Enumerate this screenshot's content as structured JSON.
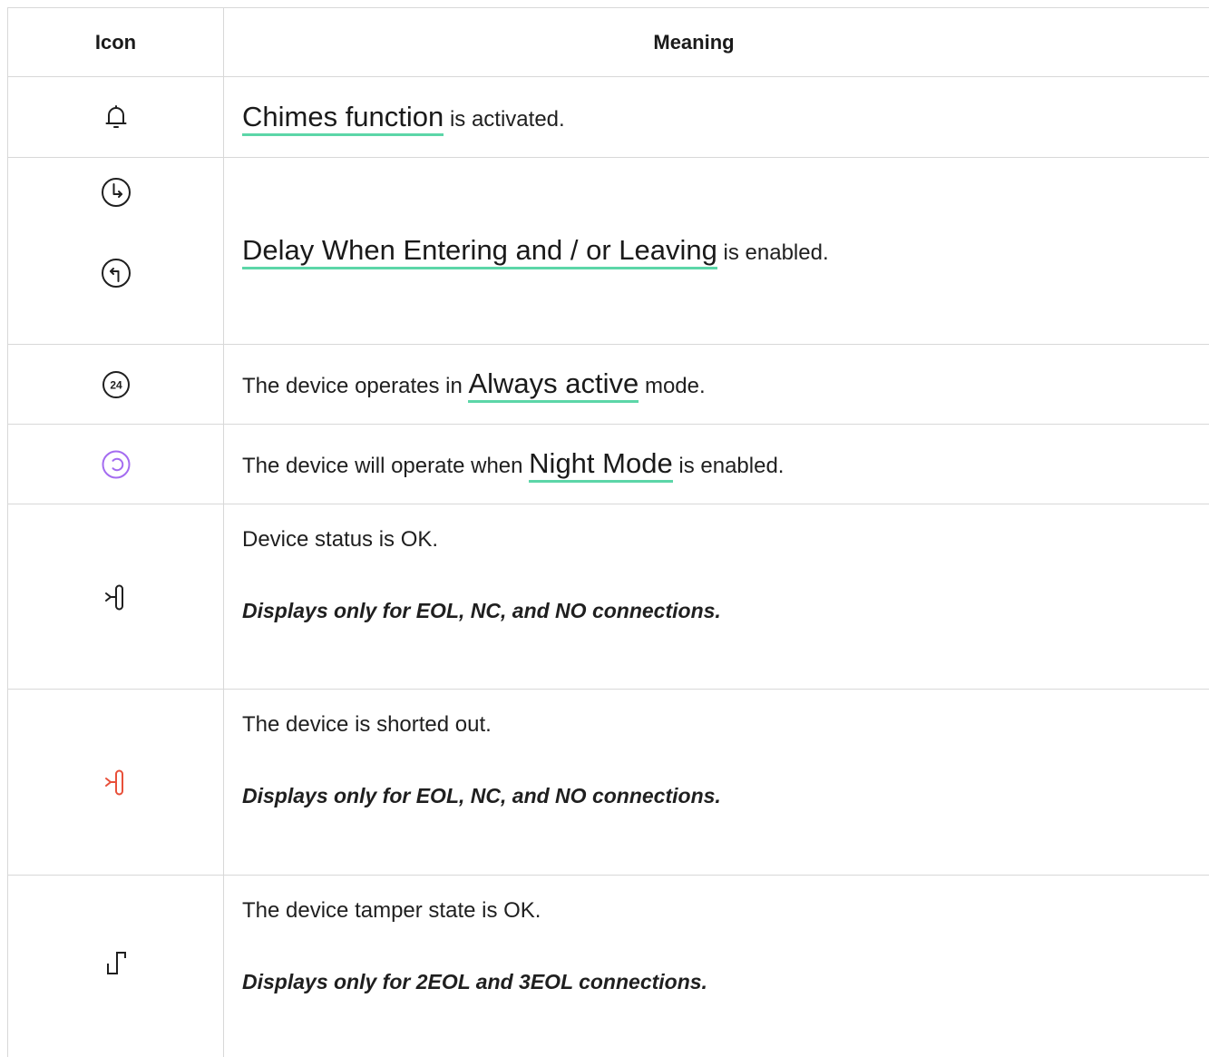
{
  "table": {
    "header": {
      "icon": "Icon",
      "meaning": "Meaning"
    },
    "rows": [
      {
        "icons": [
          "bell-icon"
        ],
        "link": "Chimes function",
        "suffix": " is activated."
      },
      {
        "icons": [
          "clock-enter-icon",
          "clock-leave-icon"
        ],
        "link": "Delay When Entering and / or Leaving",
        "suffix": " is enabled."
      },
      {
        "icons": [
          "always-active-24-icon"
        ],
        "prefix": "The device operates in ",
        "link": "Always active",
        "suffix": " mode."
      },
      {
        "icons": [
          "night-mode-icon"
        ],
        "prefix": "The device will operate when ",
        "link": "Night Mode",
        "suffix": " is enabled."
      },
      {
        "icons": [
          "device-status-ok-icon"
        ],
        "text": "Device status is OK.",
        "note": "Displays only for EOL, NC, and NO connections."
      },
      {
        "icons": [
          "device-shorted-icon"
        ],
        "text": "The device is shorted out.",
        "note": "Displays only for EOL, NC, and NO connections."
      },
      {
        "icons": [
          "tamper-ok-icon"
        ],
        "text": "The device tamper state is OK.",
        "note": "Displays only for 2EOL and 3EOL connections."
      }
    ]
  },
  "colors": {
    "link_underline": "#5cd6a8",
    "night_mode_icon": "#a46cf0",
    "shorted_icon": "#e8503a",
    "border": "#d8d8d8"
  }
}
